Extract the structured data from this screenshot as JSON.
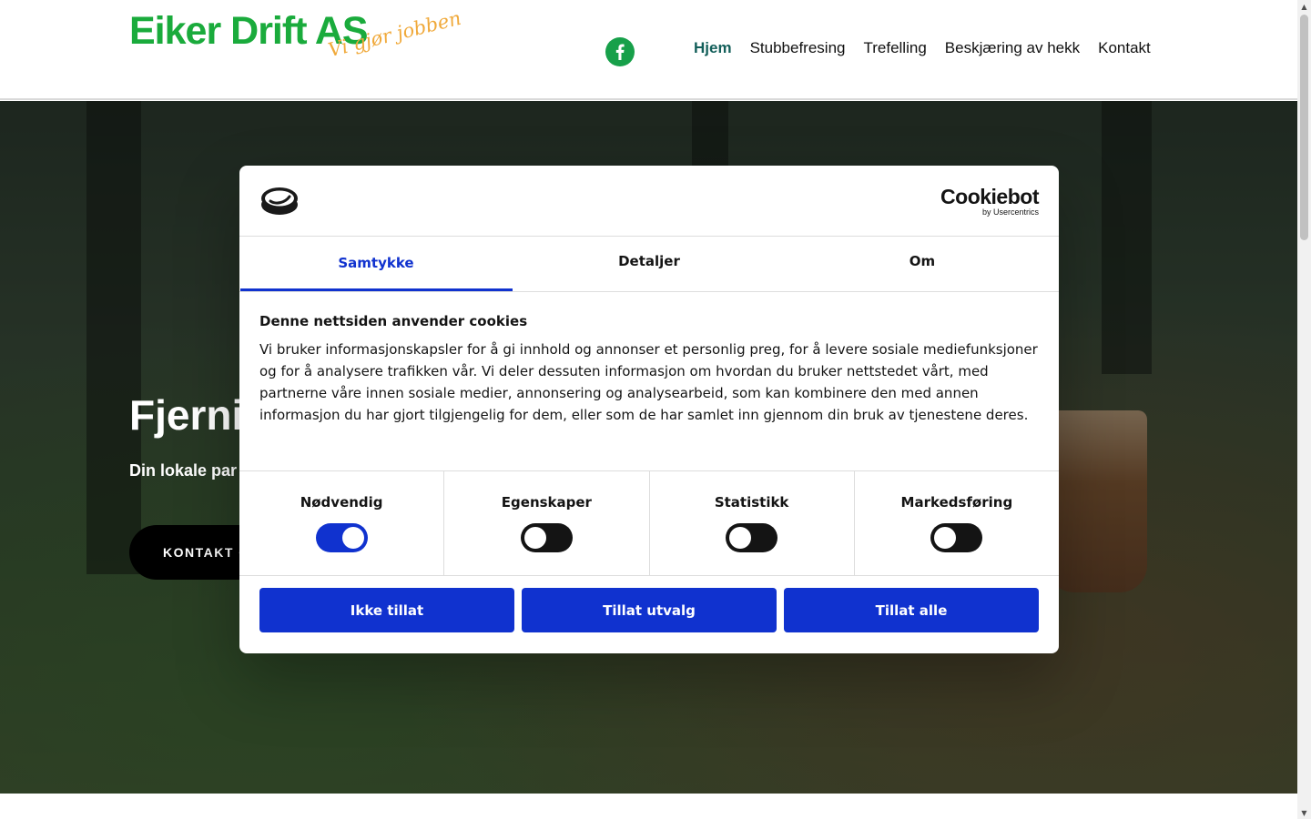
{
  "header": {
    "logo_main": "Eiker Drift AS",
    "logo_tagline": "Vi gjør jobben",
    "nav": [
      {
        "label": "Hjem",
        "active": true
      },
      {
        "label": "Stubbefresing"
      },
      {
        "label": "Trefelling"
      },
      {
        "label": "Beskjæring av hekk"
      },
      {
        "label": "Kontakt"
      }
    ],
    "social_icon": "facebook-icon"
  },
  "hero": {
    "title": "Fjerni",
    "subtitle": "Din lokale par",
    "cta_label": "KONTAKT O"
  },
  "cookie_dialog": {
    "brand_name": "Cookiebot",
    "brand_by": "by Usercentrics",
    "tabs": [
      {
        "label": "Samtykke",
        "active": true
      },
      {
        "label": "Detaljer"
      },
      {
        "label": "Om"
      }
    ],
    "heading": "Denne nettsiden anvender cookies",
    "body": "Vi bruker informasjonskapsler for å gi innhold og annonser et personlig preg, for å levere sosiale mediefunksjoner og for å analysere trafikken vår. Vi deler dessuten informasjon om hvordan du bruker nettstedet vårt, med partnerne våre innen sosiale medier, annonsering og analysearbeid, som kan kombinere den med annen informasjon du har gjort tilgjengelig for dem, eller som de har samlet inn gjennom din bruk av tjenestene deres.",
    "toggles": [
      {
        "label": "Nødvendig",
        "on": true
      },
      {
        "label": "Egenskaper",
        "on": false
      },
      {
        "label": "Statistikk",
        "on": false
      },
      {
        "label": "Markedsføring",
        "on": false
      }
    ],
    "buttons": {
      "deny": "Ikke tillat",
      "allow_selection": "Tillat utvalg",
      "allow_all": "Tillat alle"
    }
  },
  "colors": {
    "logo_green": "#1aab3c",
    "logo_orange": "#f0a93a",
    "nav_active": "#135f5a",
    "cookiebot_blue": "#1032cf"
  }
}
